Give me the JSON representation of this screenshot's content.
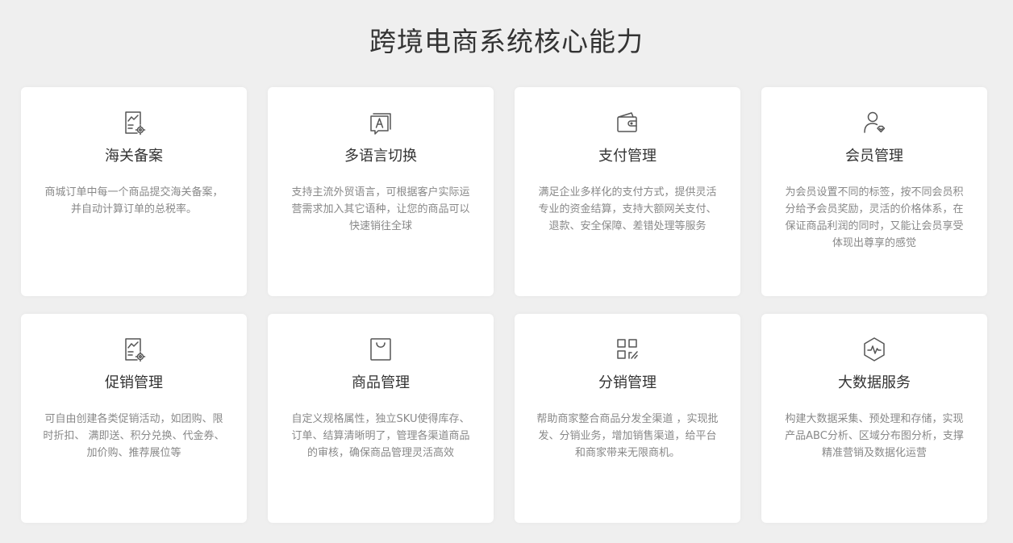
{
  "page": {
    "title": "跨境电商系统核心能力"
  },
  "cards": [
    {
      "icon": "document-chart-gear-icon",
      "title": "海关备案",
      "desc": "商城订单中每一个商品提交海关备案，并自动计算订单的总税率。"
    },
    {
      "icon": "translate-icon",
      "title": "多语言切换",
      "desc": "支持主流外贸语言，可根据客户实际运营需求加入其它语种，让您的商品可以快速销往全球"
    },
    {
      "icon": "wallet-icon",
      "title": "支付管理",
      "desc": "满足企业多样化的支付方式，提供灵活专业的资金结算，支持大额网关支付、退款、安全保障、差错处理等服务"
    },
    {
      "icon": "member-icon",
      "title": "会员管理",
      "desc": "为会员设置不同的标签，按不同会员积分给予会员奖励，灵活的价格体系，在保证商品利润的同时，又能让会员享受体现出尊享的感觉"
    },
    {
      "icon": "document-chart-gear-icon",
      "title": "促销管理",
      "desc": "可自由创建各类促销活动，如团购、限时折扣、 满即送、积分兑换、代金券、 加价购、推荐展位等"
    },
    {
      "icon": "shopping-bag-icon",
      "title": "商品管理",
      "desc": "自定义规格属性，独立SKU使得库存、订单、结算清晰明了，管理各渠道商品的审核，确保商品管理灵活高效"
    },
    {
      "icon": "grid-share-icon",
      "title": "分销管理",
      "desc": "帮助商家整合商品分发全渠道 ，实现批发、分销业务，增加销售渠道，给平台和商家带来无限商机。"
    },
    {
      "icon": "hexagon-pulse-icon",
      "title": "大数据服务",
      "desc": "构建大数据采集、预处理和存储，实现产品ABC分析、区域分布图分析，支撑精准营销及数据化运营"
    }
  ]
}
